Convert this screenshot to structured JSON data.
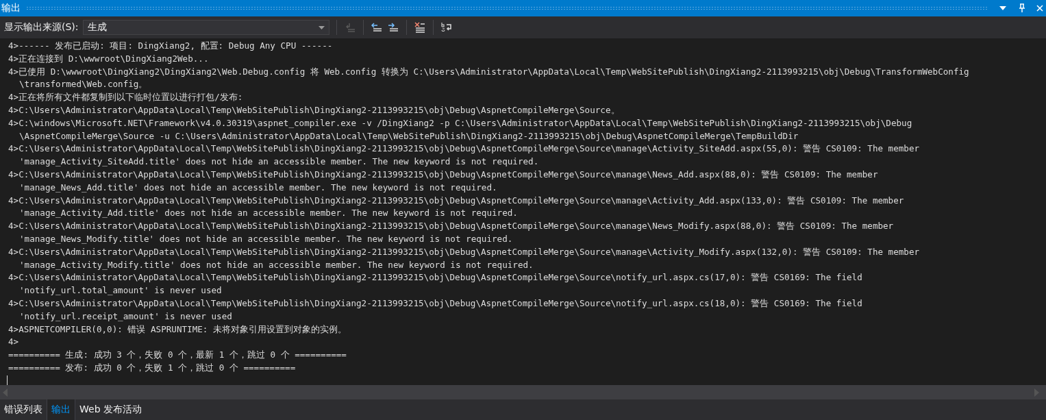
{
  "window": {
    "title": "输出"
  },
  "toolbar": {
    "source_label": "显示输出来源(S):",
    "source_value": "生成"
  },
  "output_lines": [
    [
      "4>------ 发布已启动: 项目: DingXiang2, 配置: Debug Any CPU ------"
    ],
    [
      "4>正在连接到 D:\\wwwroot\\DingXiang2Web..."
    ],
    [
      "4>已使用 D:\\wwwroot\\DingXiang2\\DingXiang2\\Web.Debug.config 将 Web.config 转换为 C:\\Users\\Administrator\\AppData\\Local\\Temp\\WebSitePublish\\DingXiang2-2113993215\\obj\\Debug\\TransformWebConfig",
      "\\transformed\\Web.config。"
    ],
    [
      "4>正在将所有文件都复制到以下临时位置以进行打包/发布:"
    ],
    [
      "4>C:\\Users\\Administrator\\AppData\\Local\\Temp\\WebSitePublish\\DingXiang2-2113993215\\obj\\Debug\\AspnetCompileMerge\\Source。"
    ],
    [
      "4>C:\\windows\\Microsoft.NET\\Framework\\v4.0.30319\\aspnet_compiler.exe -v /DingXiang2 -p C:\\Users\\Administrator\\AppData\\Local\\Temp\\WebSitePublish\\DingXiang2-2113993215\\obj\\Debug",
      "\\AspnetCompileMerge\\Source -u C:\\Users\\Administrator\\AppData\\Local\\Temp\\WebSitePublish\\DingXiang2-2113993215\\obj\\Debug\\AspnetCompileMerge\\TempBuildDir"
    ],
    [
      "4>C:\\Users\\Administrator\\AppData\\Local\\Temp\\WebSitePublish\\DingXiang2-2113993215\\obj\\Debug\\AspnetCompileMerge\\Source\\manage\\Activity_SiteAdd.aspx(55,0): 警告 CS0109: The member",
      "'manage_Activity_SiteAdd.title' does not hide an accessible member. The new keyword is not required."
    ],
    [
      "4>C:\\Users\\Administrator\\AppData\\Local\\Temp\\WebSitePublish\\DingXiang2-2113993215\\obj\\Debug\\AspnetCompileMerge\\Source\\manage\\News_Add.aspx(88,0): 警告 CS0109: The member",
      "'manage_News_Add.title' does not hide an accessible member. The new keyword is not required."
    ],
    [
      "4>C:\\Users\\Administrator\\AppData\\Local\\Temp\\WebSitePublish\\DingXiang2-2113993215\\obj\\Debug\\AspnetCompileMerge\\Source\\manage\\Activity_Add.aspx(133,0): 警告 CS0109: The member",
      "'manage_Activity_Add.title' does not hide an accessible member. The new keyword is not required."
    ],
    [
      "4>C:\\Users\\Administrator\\AppData\\Local\\Temp\\WebSitePublish\\DingXiang2-2113993215\\obj\\Debug\\AspnetCompileMerge\\Source\\manage\\News_Modify.aspx(88,0): 警告 CS0109: The member",
      "'manage_News_Modify.title' does not hide an accessible member. The new keyword is not required."
    ],
    [
      "4>C:\\Users\\Administrator\\AppData\\Local\\Temp\\WebSitePublish\\DingXiang2-2113993215\\obj\\Debug\\AspnetCompileMerge\\Source\\manage\\Activity_Modify.aspx(132,0): 警告 CS0109: The member",
      "'manage_Activity_Modify.title' does not hide an accessible member. The new keyword is not required."
    ],
    [
      "4>C:\\Users\\Administrator\\AppData\\Local\\Temp\\WebSitePublish\\DingXiang2-2113993215\\obj\\Debug\\AspnetCompileMerge\\Source\\notify_url.aspx.cs(17,0): 警告 CS0169: The field",
      "'notify_url.total_amount' is never used"
    ],
    [
      "4>C:\\Users\\Administrator\\AppData\\Local\\Temp\\WebSitePublish\\DingXiang2-2113993215\\obj\\Debug\\AspnetCompileMerge\\Source\\notify_url.aspx.cs(18,0): 警告 CS0169: The field",
      "'notify_url.receipt_amount' is never used"
    ],
    [
      "4>ASPNETCOMPILER(0,0): 错误 ASPRUNTIME: 未将对象引用设置到对象的实例。"
    ],
    [
      "4>"
    ],
    [
      "========== 生成: 成功 3 个，失败 0 个，最新 1 个，跳过 0 个 =========="
    ],
    [
      "========== 发布: 成功 0 个，失败 1 个，跳过 0 个 =========="
    ]
  ],
  "bottom_tabs": [
    {
      "label": "错误列表",
      "selected": false
    },
    {
      "label": "输出",
      "selected": true
    },
    {
      "label": "Web 发布活动",
      "selected": false
    }
  ]
}
